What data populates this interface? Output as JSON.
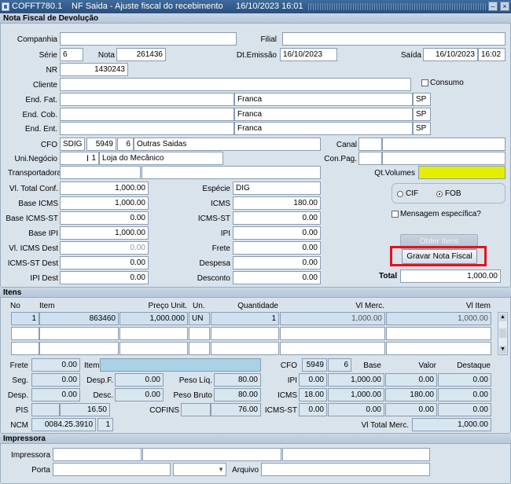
{
  "window": {
    "app_code": "COFFT780.1",
    "title": "NF Saida - Ajuste fiscal do recebimento",
    "date_time": "16/10/2023 16:01"
  },
  "header_section": {
    "title": "Nota Fiscal de Devolução",
    "companhia_label": "Companhia",
    "companhia": "",
    "filial_label": "Filial",
    "filial": "",
    "serie_label": "Série",
    "serie": "6",
    "nota_label": "Nota",
    "nota": "261436",
    "dt_emissao_label": "Dt.Emissão",
    "dt_emissao": "16/10/2023",
    "saida_label": "Saída",
    "saida_data": "16/10/2023",
    "saida_hora": "16:02",
    "nr_label": "NR",
    "nr": "1430243",
    "cliente_label": "Cliente",
    "cliente": "",
    "consumo_label": "Consumo",
    "end_fat_label": "End. Fat.",
    "end_fat": "",
    "end_fat_cidade": "Franca",
    "end_fat_uf": "SP",
    "end_cob_label": "End. Cob.",
    "end_cob": "",
    "end_cob_cidade": "Franca",
    "end_cob_uf": "SP",
    "end_ent_label": "End. Ent.",
    "end_ent": "",
    "end_ent_cidade": "Franca",
    "end_ent_uf": "SP",
    "cfo_label": "CFO",
    "cfo_tipo": "SDIG",
    "cfo_cod": "5949",
    "cfo_seq": "6",
    "cfo_desc": "Outras Saidas",
    "canal_label": "Canal",
    "uni_negocio_label": "Uni.Negócio",
    "uni_negocio_cod": "1",
    "uni_negocio_desc": "Loja do Mecânico",
    "con_pag_label": "Con.Pag.",
    "transportadora_label": "Transportadora",
    "qt_volumes_label": "Qt.Volumes",
    "vl_total_conf_label": "Vl. Total Conf.",
    "vl_total_conf": "1,000.00",
    "especie_label": "Espécie",
    "especie": "DIG",
    "base_icms_label": "Base ICMS",
    "base_icms": "1,000.00",
    "icms_label": "ICMS",
    "icms": "180.00",
    "base_icms_st_label": "Base ICMS-ST",
    "base_icms_st": "0.00",
    "icms_st_label": "ICMS-ST",
    "icms_st": "0.00",
    "base_ipi_label": "Base IPI",
    "base_ipi": "1,000.00",
    "ipi_label": "IPI",
    "ipi": "0.00",
    "vl_icms_dest_label": "Vl. ICMS Dest",
    "vl_icms_dest": "0.00",
    "frete_label": "Frete",
    "frete": "0.00",
    "icms_st_dest_label": "ICMS-ST Dest",
    "icms_st_dest": "0.00",
    "despesa_label": "Despesa",
    "despesa": "0.00",
    "ipi_dest_label": "IPI Dest",
    "ipi_dest": "0.00",
    "desconto_label": "Desconto",
    "desconto": "0.00",
    "cif_label": "CIF",
    "fob_label": "FOB",
    "frete_tipo_selected": "FOB",
    "mensagem_label": "Mensagem específica?",
    "obter_itens_label": "Obter Itens",
    "gravar_label": "Gravar Nota Fiscal",
    "total_label": "Total",
    "total": "1,000.00"
  },
  "itens_section": {
    "title": "Itens",
    "columns": {
      "no": "No",
      "item": "Item",
      "preco": "Preço Unit.",
      "un": "Un.",
      "quantidade": "Quantidade",
      "vl_merc": "Vl Merc.",
      "vl_item": "Vl Item"
    },
    "rows": [
      {
        "no": "1",
        "item": "863460",
        "preco": "1,000.000",
        "un": "UN",
        "quantidade": "1",
        "vl_merc": "1,000.00",
        "vl_item": "1,000.00"
      }
    ],
    "detail": {
      "frete_label": "Frete",
      "frete": "0.00",
      "item_label": "Item",
      "seg_label": "Seg.",
      "seg": "0.00",
      "desp_f_label": "Desp.F.",
      "desp_f": "0.00",
      "peso_liq_label": "Peso Líq.",
      "peso_liq": "80.00",
      "desp_label": "Desp.",
      "desp": "0.00",
      "desc_label": "Desc.",
      "desc": "0.00",
      "peso_bruto_label": "Peso Bruto",
      "peso_bruto": "80.00",
      "pis_label": "PIS",
      "pis": "16.50",
      "cofins_label": "COFINS",
      "cofins": "76.00",
      "ncm_label": "NCM",
      "ncm": "0084.25.3910",
      "ncm_seq": "1",
      "cfo_label": "CFO",
      "cfo_cod": "5949",
      "cfo_seq": "6",
      "base_hdr": "Base",
      "valor_hdr": "Valor",
      "destaque_hdr": "Destaque",
      "ipi_label": "IPI",
      "ipi_aliq": "0.00",
      "ipi_base": "1,000.00",
      "ipi_valor": "0.00",
      "ipi_destaque": "0.00",
      "icms_label": "ICMS",
      "icms_aliq": "18.00",
      "icms_base": "1,000.00",
      "icms_valor": "180.00",
      "icms_destaque": "0.00",
      "icms_st_label": "ICMS-ST",
      "icms_st_aliq": "0.00",
      "icms_st_base": "0.00",
      "icms_st_valor": "0.00",
      "icms_st_destaque": "0.00",
      "vl_total_merc_label": "Vl Total Merc.",
      "vl_total_merc": "1,000.00"
    }
  },
  "impressora_section": {
    "title": "Impressora",
    "impressora_label": "Impressora",
    "porta_label": "Porta",
    "arquivo_label": "Arquivo"
  }
}
